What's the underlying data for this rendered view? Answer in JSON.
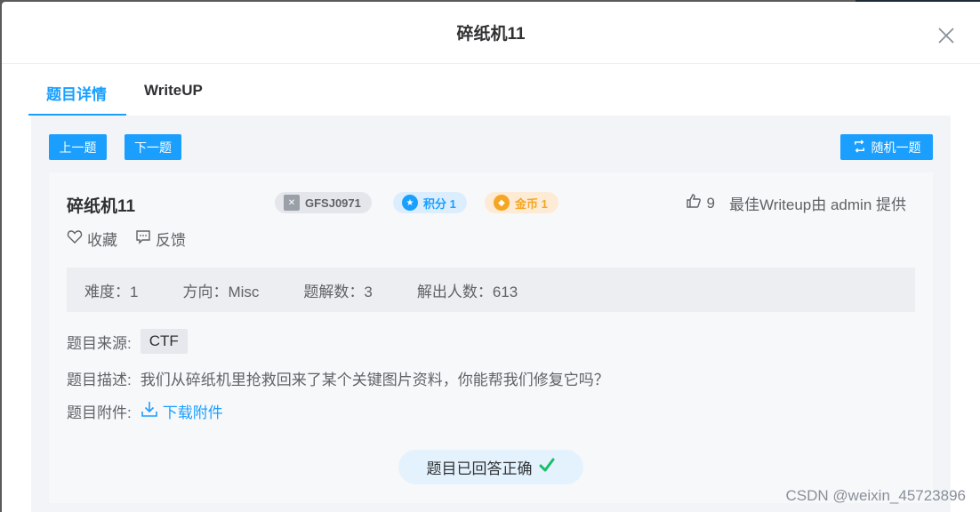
{
  "modal": {
    "title": "碎纸机11"
  },
  "tabs": [
    {
      "label": "题目详情",
      "active": true
    },
    {
      "label": "WriteUP",
      "active": false
    }
  ],
  "toolbar": {
    "prev_label": "上一题",
    "next_label": "下一题",
    "random_label": "随机一题"
  },
  "challenge": {
    "title": "碎纸机11",
    "id_tag": "GFSJ0971",
    "score_tag": "积分 1",
    "coin_tag": "金币 1",
    "likes": "9",
    "writeup_credit": "最佳Writeup由 admin 提供",
    "favorite_label": "收藏",
    "feedback_label": "反馈"
  },
  "stats": {
    "difficulty": "难度：1",
    "direction": "方向：Misc",
    "solutions": "题解数：3",
    "solvers": "解出人数：613"
  },
  "info": {
    "source_label": "题目来源:",
    "source_value": "CTF",
    "desc_label": "题目描述:",
    "desc_value": "我们从碎纸机里抢救回来了某个关键图片资料，你能帮我们修复它吗？",
    "attachment_label": "题目附件:",
    "attachment_link": "下载附件"
  },
  "status": {
    "answered_label": "题目已回答正确"
  },
  "watermark": "CSDN @weixin_45723896",
  "colors": {
    "accent": "#1a9fff",
    "success": "#19be6b",
    "coin": "#f5a623"
  }
}
